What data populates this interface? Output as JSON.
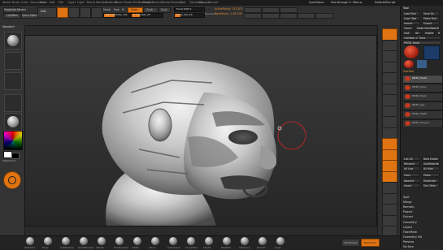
{
  "menubar": {
    "items": [
      "Alpha",
      "Brush",
      "Color",
      "Document",
      "Draw",
      "Edit",
      "File",
      "Layer",
      "Light",
      "Macro",
      "Marker",
      "Material",
      "Movie",
      "Picker",
      "Preferences",
      "Render",
      "Stencil",
      "Stroke",
      "Texture",
      "Tool",
      "Transform",
      "Zplugin",
      "Zscript"
    ],
    "right_items": [
      "QuickSave",
      "See-through 0",
      "Menus",
      "DefaultZScript"
    ]
  },
  "shelf": {
    "projection_master": "Projection Master",
    "lightbox": "LightBox",
    "quick_sketch": "Quick Sketch",
    "mode_buttons": [
      "Edit",
      "Draw",
      "Move",
      "Scale",
      "Rotate"
    ],
    "mrgb": "Mrgb",
    "rgb": "Rgb",
    "m": "M",
    "zadd": "Zadd",
    "zsub": "Zsub",
    "zcut": "Zcut",
    "rgb_intensity": "Rgb Intensity 100",
    "z_intensity": "Z Intensity 25",
    "focal_shift": "Focal Shift 0",
    "draw_size": "Draw Size 64",
    "dynamic": "Dynamic",
    "active_points": "ActivePoints: 742,873",
    "total_points": "TotalPoints: 1.481 Mil"
  },
  "left_tray": {
    "brush_label": "Standard",
    "color_switch": "SwitchColor"
  },
  "right_dock": {
    "buttons": [
      "BPR",
      "SPix 3",
      "Scroll",
      "Zoom",
      "Actual",
      "AAHalf",
      "Persp",
      "Floor",
      "Local",
      "L.Sym",
      "Frame",
      "Move",
      "Scale",
      "Rotate",
      "Line Fill",
      "Transp",
      "Ghost",
      "Solo",
      "Xpose"
    ]
  },
  "tool": {
    "title": "Tool",
    "load_tool": "Load Tool",
    "save_as": "Save As",
    "copy_tool": "Copy Tool",
    "paste_tool": "Paste Tool",
    "import": "Import",
    "export": "Export",
    "clone": "Clone",
    "make_polymesh": "Make PolyMesh3D",
    "goz": "GoZ",
    "all": "All",
    "visible": "Visible",
    "r": "R",
    "lightbox_tools": "Lightbox > Tools",
    "current_tool": "PM3D_Head",
    "subtool_header": "SubTool",
    "subtools": [
      "PM3D_Head",
      "PM3D_Eye1",
      "PM3D_Eye2",
      "PM3D_Jaw",
      "PM3D_Teeth",
      "PM3D_Tongue"
    ],
    "list_all": "List All",
    "new_folder": "New Folder",
    "rename": "Rename",
    "auto_reorder": "AutoReorder",
    "all_low": "All Low",
    "all_high": "All High",
    "copy": "Copy",
    "paste": "Paste",
    "append": "Append",
    "duplicate": "Duplicate",
    "insert": "Insert",
    "delete": "Del Other",
    "split": "Split",
    "merge": "Merge",
    "remesh": "Remesh",
    "project": "Project",
    "extract": "Extract",
    "sections": [
      "Geometry",
      "Layers",
      "FiberMesh",
      "Geometry HD",
      "Preview",
      "Surface"
    ]
  },
  "bottom_shelf": {
    "brushes": [
      "Standard",
      "Move",
      "ClayBuildup",
      "DamStandard",
      "hPolish",
      "TrimDynamic",
      "Inflate",
      "Pinch",
      "SnakeHook",
      "CurveTube",
      "Slash3",
      "MaskPen",
      "ClipCurve",
      "Smooth",
      "Layer"
    ],
    "buttons": [
      "Dynamesh",
      "Resolution"
    ]
  }
}
